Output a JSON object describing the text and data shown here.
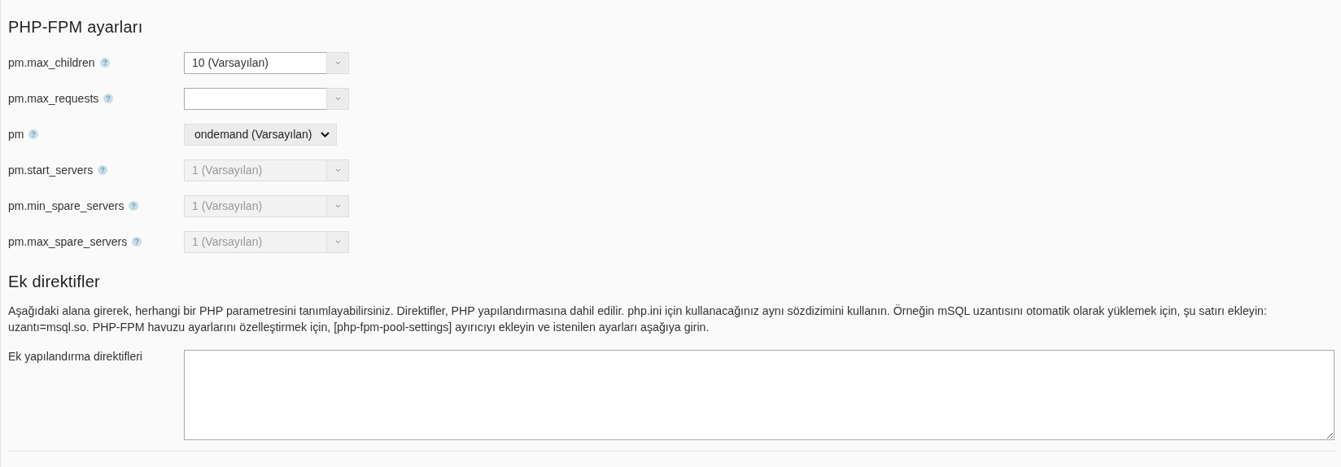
{
  "php_fpm_settings": {
    "title": "PHP-FPM ayarları",
    "fields": [
      {
        "label": "pm.max_children",
        "kind": "combo",
        "value": "10 (Varsayılan)",
        "disabled": false
      },
      {
        "label": "pm.max_requests",
        "kind": "combo",
        "disabled": false
      },
      {
        "label": "pm",
        "kind": "select",
        "value": "ondemand (Varsayılan)",
        "disabled": false
      },
      {
        "label": "pm.start_servers",
        "kind": "combo",
        "value": "1 (Varsayılan)",
        "disabled": true
      },
      {
        "label": "pm.min_spare_servers",
        "kind": "combo",
        "value": "1 (Varsayılan)",
        "disabled": true
      },
      {
        "label": "pm.max_spare_servers",
        "kind": "combo",
        "value": "1 (Varsayılan)",
        "disabled": true
      }
    ]
  },
  "additional_directives": {
    "title": "Ek direktifler",
    "description": "Aşağıdaki alana girerek, herhangi bir PHP parametresini tanımlayabilirsiniz. Direktifler, PHP yapılandırmasına dahil edilir. php.ini için kullanacağınız aynı sözdizimini kullanın. Örneğin mSQL uzantısını otomatik olarak yüklemek için, şu satırı ekleyin: uzantı=msql.so. PHP-FPM havuzu ayarlarını özelleştirmek için, [php-fpm-pool-settings] ayırıcıyı ekleyin ve istenilen ayarları aşağıya girin.",
    "field_label": "Ek yapılandırma direktifleri"
  }
}
